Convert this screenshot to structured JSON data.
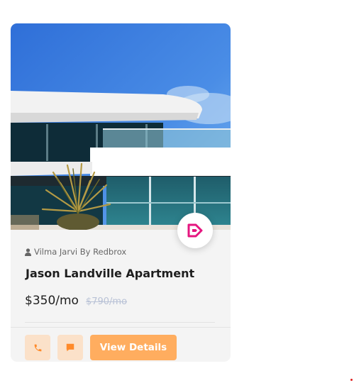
{
  "listing": {
    "agent": "Vilma Jarvi By Redbrox",
    "title": "Jason Landville Apartment",
    "price": "$350/mo",
    "old_price": "$790/mo",
    "photo_subject": "modern white apartment building with teal glass balconies and palm plant",
    "brand_icon": "brand-logo-icon"
  },
  "actions": {
    "call_icon": "phone-icon",
    "chat_icon": "chat-icon",
    "view_label": "View Details"
  },
  "colors": {
    "accent": "#ffad5f",
    "accent_soft": "#fbe1c9",
    "brand": "#e5167f",
    "card_bg": "#f4f4f4"
  }
}
